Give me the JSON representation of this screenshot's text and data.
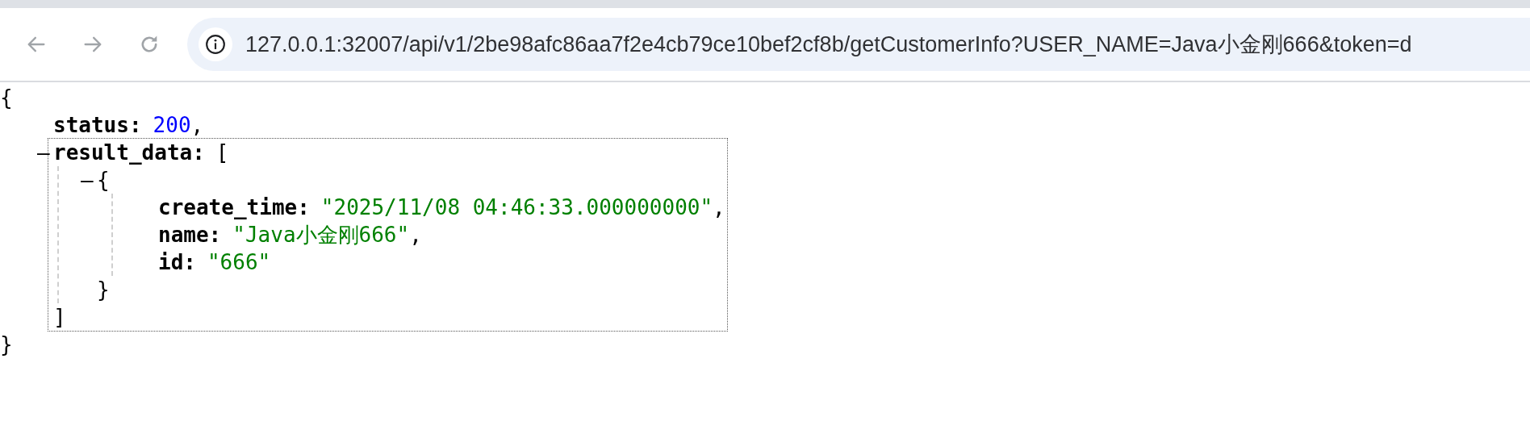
{
  "toolbar": {
    "buttons": [
      {
        "kind": "back"
      },
      {
        "kind": "forward"
      },
      {
        "kind": "reload"
      }
    ],
    "address_bar": {
      "url": "127.0.0.1:32007/api/v1/2be98afc86aa7f2e4cb79ce10bef2cf8b/getCustomerInfo?USER_NAME=Java小金刚666&token=d"
    }
  },
  "json_view": {
    "open": "{",
    "close": "}",
    "children": [
      {
        "kind": "number",
        "key": "status:",
        "value": "200",
        "comma": ","
      },
      {
        "kind": "array",
        "toggle": "–",
        "highlighted": true,
        "key": "result_data:",
        "open": "[",
        "close": "]",
        "children": [
          {
            "kind": "object",
            "toggle": "–",
            "open": "{",
            "close": "}",
            "children": [
              {
                "kind": "string",
                "key": "create_time:",
                "value": "\"2025/11/08 04:46:33.000000000\"",
                "comma": ","
              },
              {
                "kind": "string",
                "key": "name:",
                "value": "\"Java小金刚666\"",
                "comma": ","
              },
              {
                "kind": "string",
                "key": "id:",
                "value": "\"666\""
              }
            ]
          }
        ]
      }
    ]
  }
}
